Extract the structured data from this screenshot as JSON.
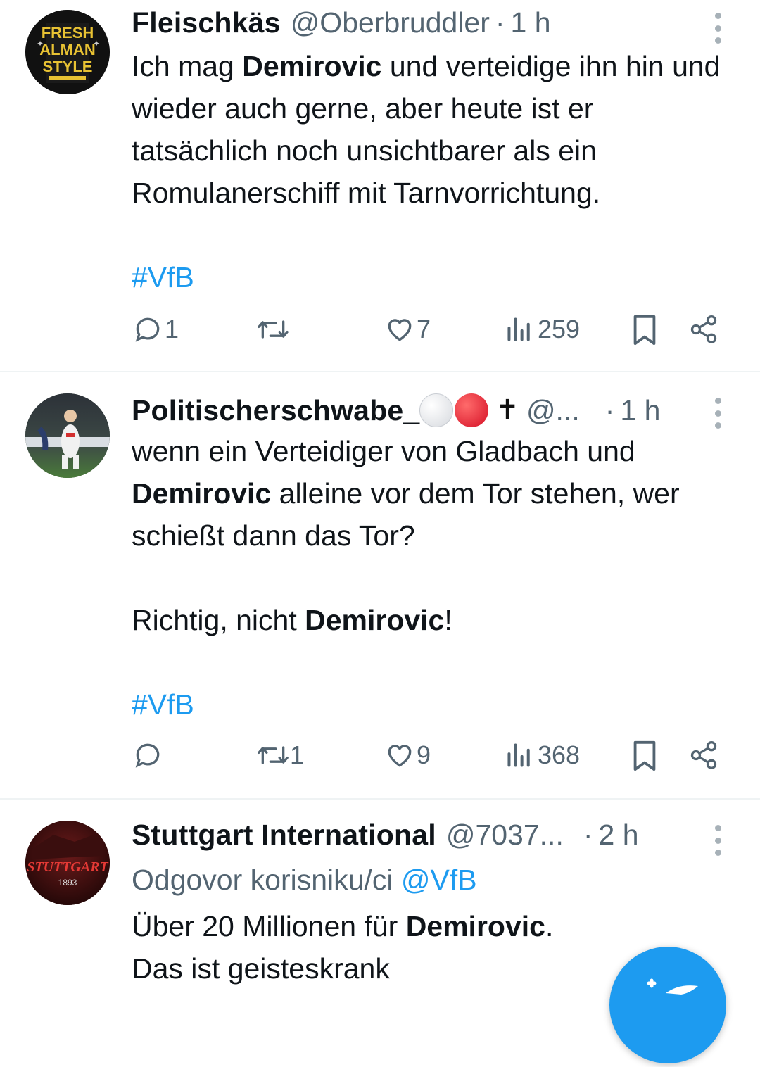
{
  "tweets": [
    {
      "name": "Fleischkäs",
      "handle": "@Oberbruddler",
      "dot": "·",
      "time": "1 h",
      "avatar_text": [
        "FRESH",
        "ALMAN",
        "STYLE"
      ],
      "body_parts": [
        {
          "t": "Ich mag ",
          "b": false
        },
        {
          "t": "Demirovic",
          "b": true
        },
        {
          "t": " und verteidige ihn hin und wieder auch gerne, aber heute ist er tatsächlich noch unsichtbarer als ein Romulanerschiff mit Tarnvorrichtung.",
          "b": false
        }
      ],
      "hashtag": "#VfB",
      "replies": "1",
      "retweets": "",
      "likes": "7",
      "views": "259"
    },
    {
      "name": "Politischerschwabe_",
      "handle": "@...",
      "dot": "·",
      "time": "1 h",
      "line1_parts": [
        {
          "t": "wenn ein Verteidiger von Gladbach und ",
          "b": false
        },
        {
          "t": "Demirovic",
          "b": true
        },
        {
          "t": " alleine vor dem Tor stehen, wer schießt dann das Tor?",
          "b": false
        }
      ],
      "line2_parts": [
        {
          "t": "Richtig, nicht ",
          "b": false
        },
        {
          "t": "Demirovic",
          "b": true
        },
        {
          "t": "!",
          "b": false
        }
      ],
      "hashtag": "#VfB",
      "replies": "",
      "retweets": "1",
      "likes": "9",
      "views": "368"
    },
    {
      "name": "Stuttgart International",
      "handle": "@7037...",
      "dot": "·",
      "time": "2 h",
      "avatar_text": "STUTTGART",
      "avatar_year": "1893",
      "reply_prefix": "Odgovor korisniku/ci",
      "reply_mention": "@VfB",
      "body_parts": [
        {
          "t": "Über 20 Millionen für ",
          "b": false
        },
        {
          "t": "Demirovic",
          "b": true
        },
        {
          "t": ".",
          "b": false
        }
      ],
      "line2": "Das ist geisteskrank"
    }
  ],
  "colors": {
    "accent": "#1d9bf0",
    "muted": "#536471",
    "text": "#0f1419",
    "divider": "#eff3f4"
  },
  "icons": [
    "reply-icon",
    "retweet-icon",
    "like-icon",
    "views-icon",
    "bookmark-icon",
    "share-icon",
    "more-icon",
    "compose-icon"
  ]
}
